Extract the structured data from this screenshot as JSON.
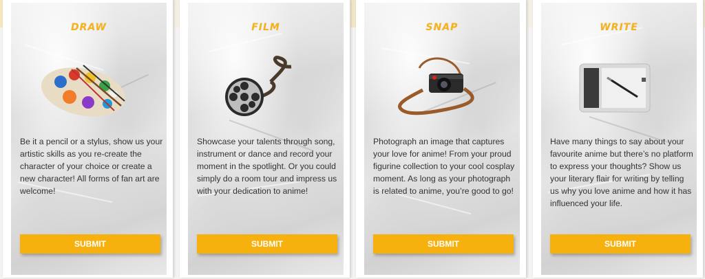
{
  "accent_color": "#f6b10f",
  "cards": [
    {
      "title": "DRAW",
      "icon": "paint-palette-icon",
      "description": "Be it a pencil or a stylus, show us your artistic skills as you re-create the character of your choice or create a new character! All forms of fan art are welcome!",
      "submit_label": "SUBMIT"
    },
    {
      "title": "FILM",
      "icon": "film-reel-icon",
      "description": "Showcase your talents through song, instrument or dance and record your moment in the spotlight. Or you could simply do a room tour and impress us with your dedication to anime!",
      "submit_label": "SUBMIT"
    },
    {
      "title": "SNAP",
      "icon": "camera-icon",
      "description": "Photograph an image that captures your love for anime! From your proud figurine collection to your cool cosplay moment. As long as your photograph is related to anime, you’re good to go!",
      "submit_label": "SUBMIT"
    },
    {
      "title": "WRITE",
      "icon": "drawing-tablet-icon",
      "description": "Have many things to say about your favourite anime but there’s no platform to express your thoughts? Show us your literary flair for writing by telling us why you love anime and how it has influenced your life.",
      "submit_label": "SUBMIT"
    }
  ]
}
